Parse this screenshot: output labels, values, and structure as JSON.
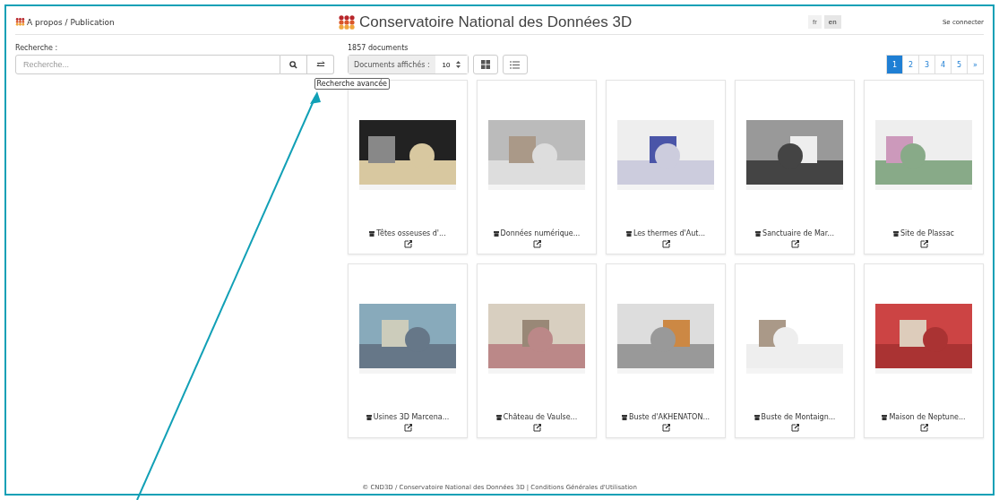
{
  "header": {
    "breadcrumb": "A propos / Publication",
    "title": "Conservatoire National des Données 3D",
    "languages": [
      {
        "label": "fr",
        "selected": false
      },
      {
        "label": "en",
        "selected": true
      }
    ],
    "login": "Se connecter"
  },
  "search": {
    "label": "Recherche :",
    "placeholder": "Recherche...",
    "tooltip": "Recherche avancée"
  },
  "results": {
    "count": "1857 documents",
    "per_page_label": "Documents affichés :",
    "per_page_value": "10"
  },
  "pagination": [
    {
      "label": "1",
      "selected": true
    },
    {
      "label": "2",
      "selected": false
    },
    {
      "label": "3",
      "selected": false
    },
    {
      "label": "4",
      "selected": false
    },
    {
      "label": "5",
      "selected": false
    },
    {
      "label": "»",
      "selected": false
    }
  ],
  "cards": [
    {
      "title": "Têtes osseuses d'..."
    },
    {
      "title": "Données numérique..."
    },
    {
      "title": "Les thermes d'Aut..."
    },
    {
      "title": "Sanctuaire de Mar..."
    },
    {
      "title": "Site de Plassac"
    },
    {
      "title": "Usines 3D Marcena..."
    },
    {
      "title": "Château de Vaulse..."
    },
    {
      "title": "Buste d'AKHENATON..."
    },
    {
      "title": "Buste de Montaign..."
    },
    {
      "title": "Maison de Neptune..."
    }
  ],
  "footer": {
    "text": "© CND3D / Conservatoire National des Données 3D | Conditions Générales d'Utilisation"
  }
}
